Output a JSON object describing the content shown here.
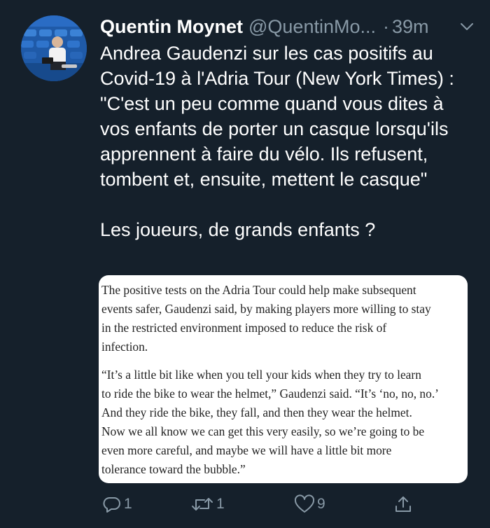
{
  "tweet": {
    "display_name": "Quentin Moynet",
    "handle": "@QuentinMo...",
    "separator": "·",
    "time": "39m",
    "text_p1": "Andrea Gaudenzi sur les cas positifs au Covid-19 à l'Adria Tour (New York Times) : \"C'est un peu comme quand vous dites à vos enfants de porter un casque lorsqu'ils apprennent à faire du vélo. Ils refusent, tombent et, ensuite, mettent le casque\"",
    "text_p2": "Les joueurs, de grands enfants ?"
  },
  "quote_image": {
    "lines_p1": [
      "The positive tests on the Adria Tour could help make subsequent",
      "events safer, Gaudenzi said, by making players more willing to stay",
      "in the restricted environment imposed to reduce the risk of",
      "infection."
    ],
    "lines_p2": [
      "“It’s a little bit like when you tell your kids when they try to learn",
      "to ride the bike to wear the helmet,” Gaudenzi said. “It’s ‘no, no, no.’",
      "And they ride the bike, they fall, and then they wear the helmet.",
      "Now we all know we can get this very easily, so we’re going to be",
      "even more careful, and maybe we will have a little bit more",
      "tolerance toward the bubble.”"
    ]
  },
  "actions": {
    "reply_count": "1",
    "retweet_count": "1",
    "like_count": "9"
  },
  "colors": {
    "background": "#15202b",
    "secondary_text": "#8899a6",
    "primary_text": "#ffffff",
    "card_background": "#ffffff"
  },
  "icons": {
    "header": "chevron-down-icon",
    "reply": "comment-bubble-icon",
    "retweet": "retweet-icon",
    "like": "heart-icon",
    "share": "share-upload-icon"
  }
}
